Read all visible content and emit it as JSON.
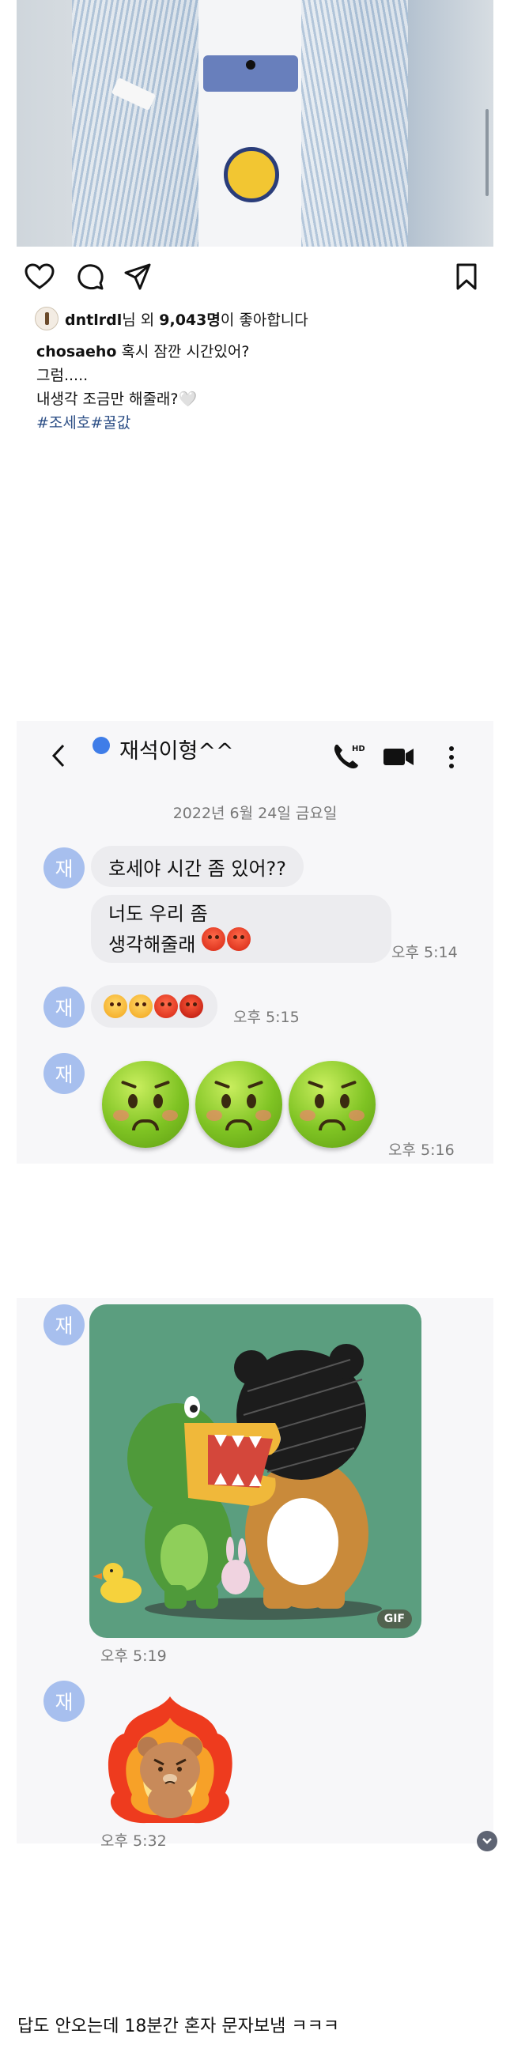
{
  "post": {
    "likes": {
      "user": "dntlrdl",
      "middle": "님 외 ",
      "count": "9,043명",
      "suffix": "이 좋아합니다"
    },
    "caption": {
      "author": "chosaeho",
      "line1": "혹시 잠깐 시간있어?",
      "line2": "그럼.....",
      "line3": "내생각 조금만 해줄래?🤍",
      "hashtags": "#조세호#꿀값"
    }
  },
  "chat1": {
    "contact_name": "재석이형^^",
    "hd_label": "HD",
    "date": "2022년 6월 24일 금요일",
    "avatar_label": "재",
    "messages": [
      {
        "text": "호세야 시간 좀 있어??"
      },
      {
        "line1": "너도 우리 좀",
        "line2": "생각해줄래",
        "time": "오후 5:14"
      }
    ],
    "emoji_time": "오후 5:15",
    "sick_time": "오후 5:16"
  },
  "chat2": {
    "avatar_label": "재",
    "gif_label": "GIF",
    "sticker1_time": "오후 5:19",
    "sticker2_time": "오후 5:32"
  },
  "footer": {
    "text": "답도 안오는데 18분간 혼자 문자보냄 ㅋㅋㅋ"
  },
  "colors": {
    "presence": "#3f7de8",
    "avatar": "#a7bfee",
    "bubble": "#ececef",
    "hashtag": "#2d4f86",
    "sticker_bg": "#5b9e7f"
  },
  "icons": [
    "heart-icon",
    "comment-icon",
    "send-icon",
    "bookmark-icon",
    "back-arrow-icon",
    "hd-call-icon",
    "video-call-icon",
    "more-vertical-icon",
    "scroll-down-icon"
  ]
}
